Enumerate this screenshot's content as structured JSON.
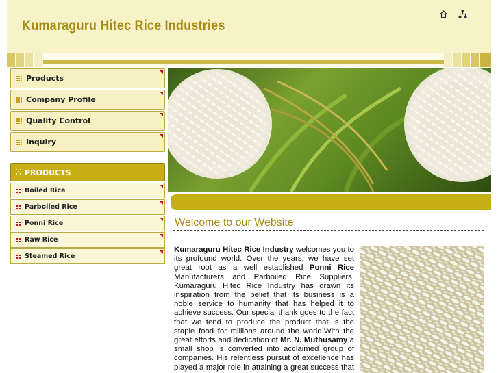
{
  "header": {
    "title": "Kumaraguru Hitec Rice Industries",
    "icons": [
      "home-icon",
      "sitemap-icon"
    ]
  },
  "colors": {
    "brand_gold": "#a58a13",
    "bar_gold": "#c6ae15",
    "nav_bg": "#f7f0c2",
    "accent_red": "#c0131b"
  },
  "nav": {
    "items": [
      {
        "label": "Products"
      },
      {
        "label": "Company Profile"
      },
      {
        "label": "Quality Control"
      },
      {
        "label": "Inquiry"
      }
    ]
  },
  "products": {
    "heading": "PRODUCTS",
    "items": [
      {
        "label": "Boiled Rice"
      },
      {
        "label": "Parboiled Rice"
      },
      {
        "label": "Ponni Rice"
      },
      {
        "label": "Raw Rice"
      },
      {
        "label": "Steamed Rice"
      }
    ]
  },
  "main": {
    "welcome": "Welcome to our Website",
    "company_name": "Kumaraguru Hitec Rice Industry",
    "text_1": " welcomes you to its profound world. Over the years, we have set great root as a well established ",
    "ponni": "Ponni Rice",
    "text_2": " Manufacturers and Parboiled Rice Suppliers. Kumaraguru Hitec Rice Industry has drawn its inspiration from the belief that its business is a noble service to humanity that has helped it to achieve success. Our special thank goes to the fact that we tend to produce the product that is the staple food for millions around the world.With the great efforts and dedication of ",
    "founder": "Mr. N. Muthusamy",
    "text_3": " a small shop is converted into acclaimed group of companies. His relentless pursuit of excellence has played a major role in attaining a great success that we now have. Kumaraguru Hitec"
  }
}
